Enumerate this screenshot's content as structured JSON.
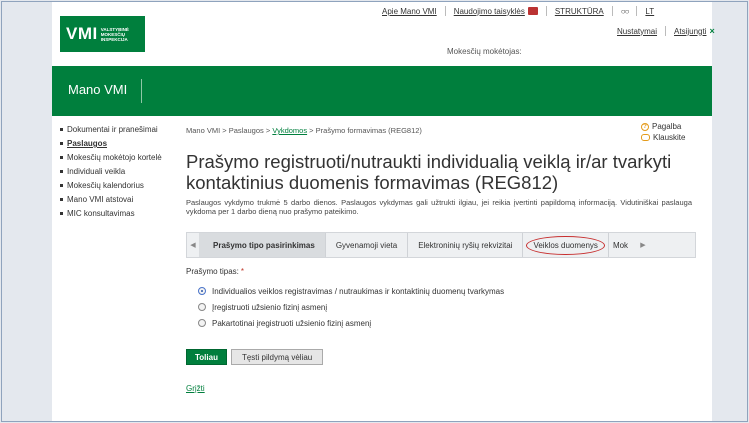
{
  "header": {
    "logo_text": "VMI",
    "logo_sub": [
      "VALSTYBINĖ",
      "MOKESČIŲ",
      "INSPEKCIJA"
    ],
    "top_links": [
      "Apie Mano VMI",
      "Naudojimo taisyklės",
      "STRUKTŪRA",
      "LT"
    ],
    "glasses_icon": "glasses-icon",
    "user_links": [
      "Nustatymai",
      "Atsijungti"
    ],
    "logout_mark": "×",
    "payer_label": "Mokesčių mokėtojas:"
  },
  "banner": {
    "title": "Mano VMI"
  },
  "sidebar": {
    "items": [
      {
        "label": "Dokumentai ir pranešimai"
      },
      {
        "label": "Paslaugos"
      },
      {
        "label": "Mokesčių mokėtojo kortelė"
      },
      {
        "label": "Individuali veikla"
      },
      {
        "label": "Mokesčių kalendorius"
      },
      {
        "label": "Mano VMI atstovai"
      },
      {
        "label": "MIC konsultavimas"
      }
    ]
  },
  "breadcrumb": {
    "items": [
      "Mano VMI",
      "Paslaugos",
      "Vykdomos",
      "Prašymo formavimas (REG812)"
    ],
    "sep": " > "
  },
  "help": {
    "help_label": "Pagalba",
    "ask_label": "Klauskite"
  },
  "page": {
    "title": "Prašymo registruoti/nutraukti individualią veiklą ir/ar tvarkyti kontaktinius duomenis formavimas (REG812)",
    "description": "Paslaugos vykdymo trukmė 5 darbo dienos. Paslaugos vykdymas gali užtrukti ilgiau, jei reikia įvertinti papildomą informaciją. Vidutiniškai paslauga vykdoma per 1 darbo dieną nuo prašymo pateikimo."
  },
  "steps": {
    "items": [
      "Prašymo tipo pasirinkimas",
      "Gyvenamoji vieta",
      "Elektroninių ryšių rekvizitai",
      "Veiklos duomenys",
      "Mok"
    ],
    "prev": "◀",
    "next": "▶"
  },
  "form": {
    "type_label": "Prašymo tipas:",
    "required_mark": "*",
    "options": [
      "Individualios veiklos registravimas / nutraukimas ir kontaktinių duomenų tvarkymas",
      "Įregistruoti užsienio fizinį asmenį",
      "Pakartotinai įregistruoti užsienio fizinį asmenį"
    ],
    "selected_index": 0
  },
  "actions": {
    "next_label": "Toliau",
    "later_label": "Tęsti pildymą vėliau",
    "back_label": "Grįžti"
  },
  "colors": {
    "brand_green": "#007f3d",
    "highlight_red": "#c72f2f"
  }
}
